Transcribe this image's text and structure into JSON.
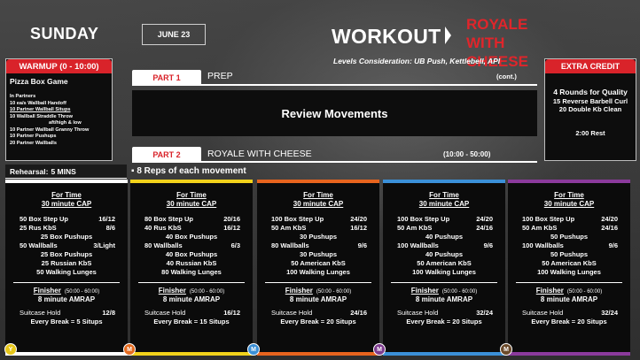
{
  "header": {
    "day": "SUNDAY",
    "date": "JUNE 23",
    "workout_label": "WORKOUT",
    "workout_name": "ROYALE WITH CHEESE",
    "levels": "Levels Consideration: UB Push, Kettlebell, API"
  },
  "warmup": {
    "tab": "WARMUP (0 - 10:00)",
    "title": "Pizza Box Game",
    "lines": [
      "In Partners",
      "10 ea/s Wallball Handoff",
      "10 Partner Wallball Situps",
      "10 Wallball Straddle Throw",
      "aft/high & low",
      "10 Partner Wallball Granny Throw",
      "10 Partner Pushups",
      "20 Partner Wallballs"
    ]
  },
  "extra_credit": {
    "tab": "EXTRA CREDIT",
    "title": "4 Rounds for Quality",
    "lines": [
      "15 Reverse Barbell Curl",
      "20 Double Kb Clean"
    ],
    "rest": "2:00 Rest"
  },
  "part1": {
    "tab": "PART 1",
    "label": "PREP",
    "cont": "(cont.)",
    "body": "Review Movements"
  },
  "part2": {
    "tab": "PART 2",
    "label": "ROYALE WITH CHEESE",
    "time": "(10:00 - 50:00)"
  },
  "rehearsal": {
    "label": "Rehearsal:",
    "value": "5 MINS"
  },
  "reps_note": "8 Reps of each movement",
  "columns": [
    {
      "h1": "For Time",
      "h2": "30 minute CAP",
      "rows": [
        [
          "50 Box Step Up",
          "16/12"
        ],
        [
          "25 Rus KbS",
          "8/6"
        ],
        [
          "25 Box Pushups",
          ""
        ],
        [
          "50 Wallballs",
          "3/Light"
        ],
        [
          "25 Box Pushups",
          ""
        ],
        [
          "25 Russian KbS",
          ""
        ],
        [
          "50 Walking Lunges",
          ""
        ]
      ],
      "finisher": "Finisher",
      "finisher_time": "(50:00 - 60:00)",
      "amrap": "8 minute AMRAP",
      "suitcase": "Suitcase Hold",
      "suitcase_val": "12/8",
      "brk": "Every Break = 5 Situps",
      "color": "#ffffff",
      "coin": "Y",
      "coin_color": "#e6c619"
    },
    {
      "h1": "For Time",
      "h2": "30 minute CAP",
      "rows": [
        [
          "80 Box Step Up",
          "20/16"
        ],
        [
          "40 Rus KbS",
          "16/12"
        ],
        [
          "40 Box Pushups",
          ""
        ],
        [
          "80 Wallballs",
          "6/3"
        ],
        [
          "40 Box Pushups",
          ""
        ],
        [
          "40 Russian KbS",
          ""
        ],
        [
          "80 Walking Lunges",
          ""
        ]
      ],
      "finisher": "Finisher",
      "finisher_time": "(50:00 - 60:00)",
      "amrap": "8 minute AMRAP",
      "suitcase": "Suitcase Hold",
      "suitcase_val": "16/12",
      "brk": "Every Break = 15 Situps",
      "color": "#f2d21b",
      "coin": "M",
      "coin_color": "#e56b1f"
    },
    {
      "h1": "For Time",
      "h2": "30 minute CAP",
      "rows": [
        [
          "100 Box Step Up",
          "24/20"
        ],
        [
          "50 Am KbS",
          "16/12"
        ],
        [
          "30 Pushups",
          ""
        ],
        [
          "80 Wallballs",
          "9/6"
        ],
        [
          "30 Pushups",
          ""
        ],
        [
          "50 American KbS",
          ""
        ],
        [
          "100 Walking Lunges",
          ""
        ]
      ],
      "finisher": "Finisher",
      "finisher_time": "(50:00 - 60:00)",
      "amrap": "8 minute AMRAP",
      "suitcase": "Suitcase Hold",
      "suitcase_val": "24/16",
      "brk": "Every Break = 20 Situps",
      "color": "#e8641e",
      "coin": "M",
      "coin_color": "#3b8fd6"
    },
    {
      "h1": "For Time",
      "h2": "30 minute CAP",
      "rows": [
        [
          "100 Box Step Up",
          "24/20"
        ],
        [
          "50 Am KbS",
          "24/16"
        ],
        [
          "40 Pushups",
          ""
        ],
        [
          "100 Wallballs",
          "9/6"
        ],
        [
          "40 Pushups",
          ""
        ],
        [
          "50 American KbS",
          ""
        ],
        [
          "100 Walking Lunges",
          ""
        ]
      ],
      "finisher": "Finisher",
      "finisher_time": "(50:00 - 60:00)",
      "amrap": "8 minute AMRAP",
      "suitcase": "Suitcase Hold",
      "suitcase_val": "32/24",
      "brk": "Every Break = 20 Situps",
      "color": "#3b90d8",
      "coin": "M",
      "coin_color": "#7e3c8f"
    },
    {
      "h1": "For Time",
      "h2": "30 minute CAP",
      "rows": [
        [
          "100 Box Step Up",
          "24/20"
        ],
        [
          "50 Am KbS",
          "24/16"
        ],
        [
          "50 Pushups",
          ""
        ],
        [
          "100 Wallballs",
          "9/6"
        ],
        [
          "50 Pushups",
          ""
        ],
        [
          "50 American KbS",
          ""
        ],
        [
          "100 Walking Lunges",
          ""
        ]
      ],
      "finisher": "Finisher",
      "finisher_time": "(50:00 - 60:00)",
      "amrap": "8 minute AMRAP",
      "suitcase": "Suitcase Hold",
      "suitcase_val": "32/24",
      "brk": "Every Break = 20 Situps",
      "color": "#8b3a9c",
      "coin": "M",
      "coin_color": "#6b4a2a"
    }
  ],
  "colors": {
    "accent": "#d9232a"
  }
}
